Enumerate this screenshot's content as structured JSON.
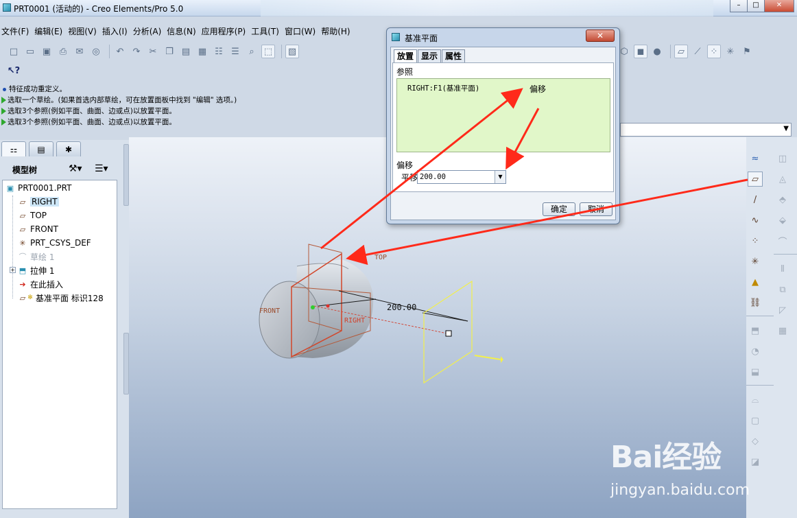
{
  "window": {
    "title": "PRT0001 (活动的) - Creo Elements/Pro 5.0",
    "minimize": "–",
    "maximize": "□",
    "close": "✕"
  },
  "menu": {
    "items": [
      "文件(F)",
      "编辑(E)",
      "视图(V)",
      "插入(I)",
      "分析(A)",
      "信息(N)",
      "应用程序(P)",
      "工具(T)",
      "窗口(W)",
      "帮助(H)"
    ]
  },
  "messages": [
    "特征成功重定义。",
    "选取一个草绘。(如果首选内部草绘，可在放置面板中找到 \"编辑\" 选项。)",
    "选取3个参照(例如平面、曲面、边或点)以放置平面。",
    "选取3个参照(例如平面、曲面、边或点)以放置平面。"
  ],
  "navigator": {
    "header": "模型树",
    "tree": [
      {
        "label": "PRT0001.PRT",
        "icon": "part-icon",
        "selected": false,
        "dim": false
      },
      {
        "label": "RIGHT",
        "icon": "datum-plane-icon",
        "selected": true,
        "dim": false
      },
      {
        "label": "TOP",
        "icon": "datum-plane-icon",
        "selected": false,
        "dim": false
      },
      {
        "label": "FRONT",
        "icon": "datum-plane-icon",
        "selected": false,
        "dim": false
      },
      {
        "label": "PRT_CSYS_DEF",
        "icon": "csys-icon",
        "selected": false,
        "dim": false
      },
      {
        "label": "草绘 1",
        "icon": "sketch-icon",
        "selected": false,
        "dim": true
      },
      {
        "label": "拉伸 1",
        "icon": "extrude-icon",
        "selected": false,
        "dim": false
      },
      {
        "label": "在此插入",
        "icon": "insert-here-icon",
        "selected": false,
        "dim": false
      },
      {
        "label": "基准平面 标识128",
        "icon": "datum-plane-icon",
        "selected": false,
        "dim": false
      }
    ]
  },
  "graphics": {
    "labels": {
      "front": "FRONT",
      "right": "RIGHT",
      "top": "TOP",
      "dimension": "200.00"
    },
    "colors": {
      "arrow": "#ff2a1a",
      "new_plane": "#f3f04a",
      "datum": "#c0552e"
    }
  },
  "dialog": {
    "title": "基准平面",
    "close_label": "✕",
    "tabs": [
      "放置",
      "显示",
      "属性"
    ],
    "references_label": "参照",
    "reference_item": "RIGHT:F1(基准平面)",
    "reference_constraint": "偏移",
    "offset_label": "偏移",
    "translate_label": "平移",
    "translate_value": "200.00",
    "ok_label": "确定",
    "cancel_label": "取消"
  },
  "watermark": {
    "brand": "Bai经验",
    "url": "jingyan.baidu.com"
  }
}
